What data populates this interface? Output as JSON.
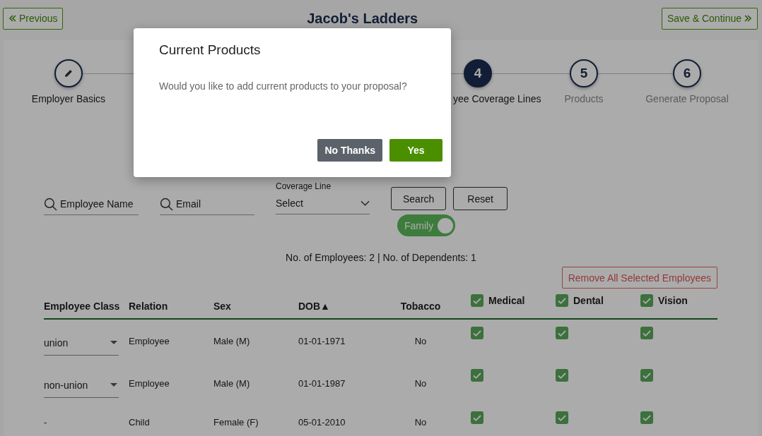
{
  "header": {
    "previous_button": "Previous",
    "title": "Jacob's Ladders",
    "save_button": "Save & Continue"
  },
  "steps": [
    {
      "completed": true,
      "active": false,
      "label": "Employer Basics"
    },
    {
      "completed": false,
      "active": true,
      "number": "4",
      "label": "yee Coverage Lines"
    },
    {
      "completed": false,
      "active": false,
      "number": "5",
      "label": "Products"
    },
    {
      "completed": false,
      "active": false,
      "number": "6",
      "label": "Generate Proposal"
    }
  ],
  "filters": {
    "name_placeholder": "Employee Name",
    "email_placeholder": "Email",
    "coverage_label": "Coverage Line",
    "coverage_value": "Select",
    "search_button": "Search",
    "reset_button": "Reset",
    "family_toggle": {
      "label": "Family",
      "on": true
    }
  },
  "counts": "No. of Employees: 2 | No. of Dependents: 1",
  "remove_button": "Remove All Selected Employees",
  "table": {
    "columns": [
      {
        "label": "Employee Class",
        "kind": "text"
      },
      {
        "label": "Relation",
        "kind": "text"
      },
      {
        "label": "Sex",
        "kind": "text"
      },
      {
        "label": "DOB▲",
        "kind": "text"
      },
      {
        "label": "Tobacco",
        "kind": "center"
      },
      {
        "label": "Medical",
        "kind": "check",
        "checked": true
      },
      {
        "label": "Dental",
        "kind": "check",
        "checked": true
      },
      {
        "label": "Vision",
        "kind": "check",
        "checked": true
      }
    ],
    "rows": [
      {
        "class": "union",
        "kind": "select",
        "relation": "Employee",
        "sex": "Male (M)",
        "dob": "01-01-1971",
        "tobacco": "No",
        "medical": true,
        "dental": true,
        "vision": true
      },
      {
        "class": "non-union",
        "kind": "select",
        "relation": "Employee",
        "sex": "Male (M)",
        "dob": "01-01-1987",
        "tobacco": "No",
        "medical": true,
        "dental": true,
        "vision": true
      },
      {
        "class": "-",
        "kind": "text",
        "relation": "Child",
        "sex": "Female (F)",
        "dob": "05-01-2010",
        "tobacco": "No",
        "medical": true,
        "dental": true,
        "vision": true
      }
    ]
  },
  "modal": {
    "title": "Current Products",
    "message": "Would you like to add current products to your proposal?",
    "no_button": "No Thanks",
    "yes_button": "Yes"
  }
}
